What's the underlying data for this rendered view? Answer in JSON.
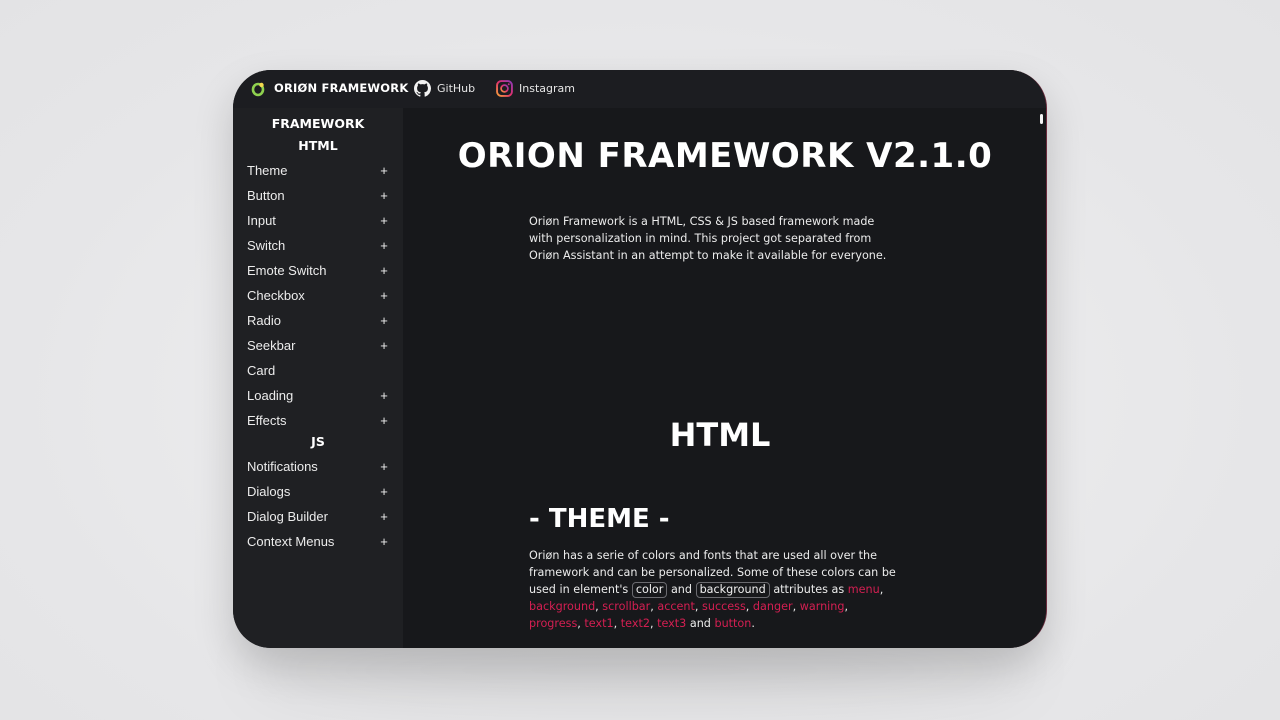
{
  "topbar": {
    "brand": "ORIØN FRAMEWORK",
    "links": [
      {
        "label": "GitHub",
        "icon": "github-icon"
      },
      {
        "label": "Instagram",
        "icon": "instagram-icon"
      }
    ]
  },
  "sidebar": {
    "headings": {
      "framework": "FRAMEWORK",
      "html": "HTML",
      "js": "JS"
    },
    "html_items": [
      {
        "label": "Theme",
        "expandable": "+"
      },
      {
        "label": "Button",
        "expandable": "+"
      },
      {
        "label": "Input",
        "expandable": "+"
      },
      {
        "label": "Switch",
        "expandable": "+"
      },
      {
        "label": "Emote Switch",
        "expandable": "+"
      },
      {
        "label": "Checkbox",
        "expandable": "+"
      },
      {
        "label": "Radio",
        "expandable": "+"
      },
      {
        "label": "Seekbar",
        "expandable": "+"
      },
      {
        "label": "Card",
        "expandable": ""
      },
      {
        "label": "Loading",
        "expandable": "+"
      },
      {
        "label": "Effects",
        "expandable": "+"
      }
    ],
    "js_items": [
      {
        "label": "Notifications",
        "expandable": "+"
      },
      {
        "label": "Dialogs",
        "expandable": "+"
      },
      {
        "label": "Dialog Builder",
        "expandable": "+"
      },
      {
        "label": "Context Menus",
        "expandable": "+"
      }
    ]
  },
  "main": {
    "title": "ORION FRAMEWORK V2.1.0",
    "intro": "Oriøn Framework is a HTML, CSS & JS based framework made with personalization in mind. This project got separated from Oriøn Assistant in an attempt to make it available for everyone.",
    "html_heading": "HTML",
    "theme_heading": "- THEME -",
    "theme_text": {
      "part1": "Oriøn has a serie of colors and fonts that are used all over the framework and can be personalized. Some of these colors can be used in element's",
      "code1": "color",
      "and1": "and",
      "code2": "background",
      "part2": "attributes as",
      "colors": [
        "menu",
        "background",
        "scrollbar",
        "accent",
        "success",
        "danger",
        "warning",
        "progress",
        "text1",
        "text2",
        "text3"
      ],
      "and2": "and",
      "last_color": "button"
    }
  },
  "colors": {
    "accent": "#d41f52",
    "window_bg": "#1f2024",
    "main_bg": "#17181b"
  }
}
